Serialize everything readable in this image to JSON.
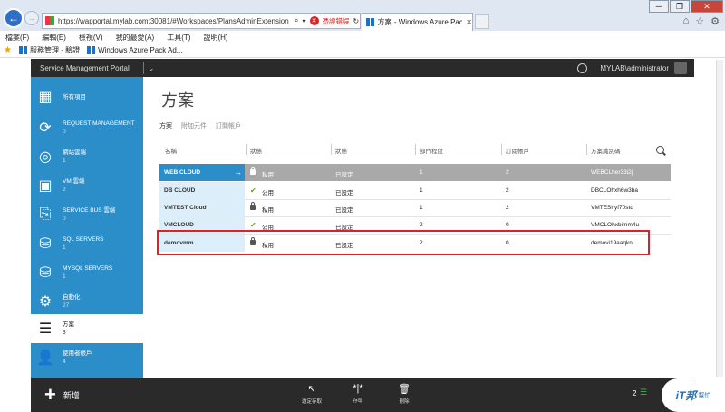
{
  "browser": {
    "url": "https://wapportal.mylab.com:30081/#Workspaces/PlansAdminExtension",
    "cert_error": "憑證錯誤",
    "tab_title": "方案 - Windows Azure Pack",
    "menu": [
      "檔案(F)",
      "編輯(E)",
      "檢視(V)",
      "我的最愛(A)",
      "工具(T)",
      "說明(H)"
    ],
    "favorites": [
      "服務管理 - 驗證",
      "Windows Azure Pack Ad..."
    ],
    "win_buttons": {
      "minimize": "─",
      "restore": "❐",
      "close": "✕"
    }
  },
  "portal": {
    "title": "Service Management Portal",
    "user": "MYLAB\\administrator"
  },
  "sidebar": {
    "items": [
      {
        "label": "所有項目",
        "count": "",
        "icon": "grid-icon"
      },
      {
        "label": "REQUEST MANAGEMENT",
        "count": "0",
        "icon": "request-icon"
      },
      {
        "label": "網站雲端",
        "count": "1",
        "icon": "website-icon"
      },
      {
        "label": "VM 雲端",
        "count": "2",
        "icon": "vm-icon"
      },
      {
        "label": "SERVICE BUS 雲端",
        "count": "0",
        "icon": "servicebus-icon"
      },
      {
        "label": "SQL SERVERS",
        "count": "1",
        "icon": "sql-icon"
      },
      {
        "label": "MYSQL SERVERS",
        "count": "1",
        "icon": "mysql-icon"
      },
      {
        "label": "自動化",
        "count": "27",
        "icon": "automation-icon"
      },
      {
        "label": "方案",
        "count": "5",
        "icon": "plans-icon"
      },
      {
        "label": "使用者帳戶",
        "count": "4",
        "icon": "user-icon"
      }
    ]
  },
  "main": {
    "title": "方案",
    "tabs": [
      "方案",
      "附加元件",
      "訂閱帳戶"
    ],
    "columns": [
      "名稱",
      "狀態",
      "狀態",
      "部門程度",
      "訂閱帳戶",
      "方案識別碼"
    ],
    "rows": [
      {
        "name": "WEB CLOUD",
        "access": "私用",
        "status": "已設定",
        "level": "1",
        "subs": "2",
        "id": "WEBCLher33i2j",
        "selected": true,
        "icon": "lock"
      },
      {
        "name": "DB CLOUD",
        "access": "公用",
        "status": "已設定",
        "level": "1",
        "subs": "2",
        "id": "DBCLOhxh6w3ba",
        "selected": false,
        "icon": "check"
      },
      {
        "name": "VMTEST Cloud",
        "access": "私用",
        "status": "已設定",
        "level": "1",
        "subs": "2",
        "id": "VMTEShyf70stq",
        "selected": false,
        "icon": "lock"
      },
      {
        "name": "VMCLOUD",
        "access": "公用",
        "status": "已設定",
        "level": "2",
        "subs": "0",
        "id": "VMCLOhxbimm4u",
        "selected": false,
        "icon": "check"
      },
      {
        "name": "demovmm",
        "access": "私用",
        "status": "已設定",
        "level": "2",
        "subs": "0",
        "id": "demovi19aaqkn",
        "selected": false,
        "icon": "lock"
      }
    ]
  },
  "bottom_bar": {
    "new_label": "新增",
    "commands": [
      {
        "label": "邀定存取",
        "icon": "access-icon"
      },
      {
        "label": "存取",
        "icon": "split-icon"
      },
      {
        "label": "刪除",
        "icon": "trash-icon"
      }
    ],
    "notification_count": "2"
  },
  "watermark": {
    "brand": "iT邦",
    "sub": "幫忙"
  },
  "colors": {
    "sidebar": "#2c8ec9",
    "header": "#2a2a2a",
    "selected_row": "#a9a9a9",
    "highlight": "#d8232a"
  }
}
